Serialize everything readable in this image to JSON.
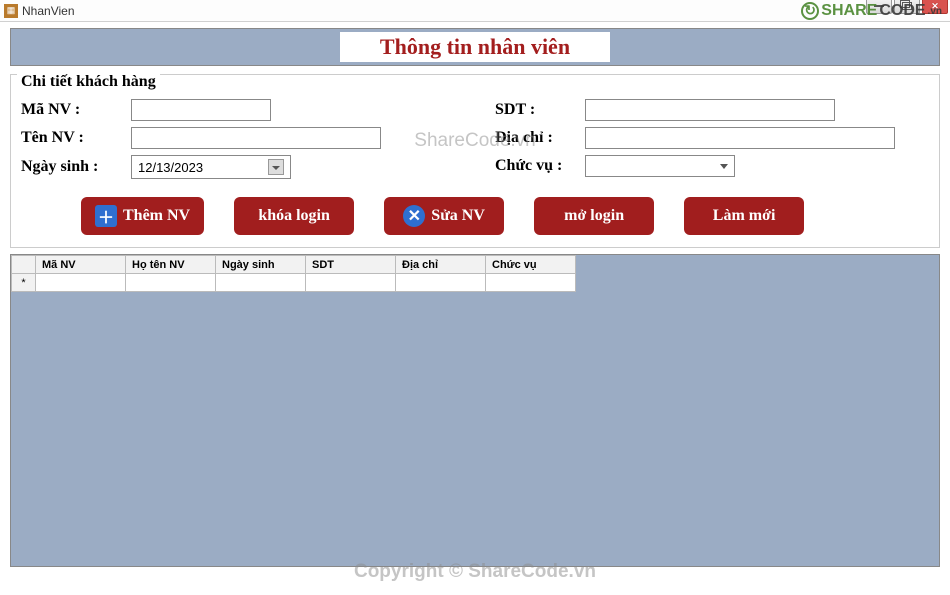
{
  "window": {
    "title": "NhanVien"
  },
  "watermark": {
    "logo_text_1": "SHARE",
    "logo_text_2": "CODE",
    "logo_text_3": ".vn",
    "center": "ShareCode.vn",
    "footer": "Copyright © ShareCode.vn"
  },
  "banner": {
    "title": "Thông tin nhân viên"
  },
  "groupbox": {
    "legend": "Chi tiết khách hàng",
    "labels": {
      "ma_nv": "Mã NV :",
      "sdt": "SDT :",
      "ten_nv": "Tên NV :",
      "dia_chi": "Địa chỉ :",
      "ngay_sinh": "Ngày sinh :",
      "chuc_vu": "Chức vụ :"
    },
    "values": {
      "ma_nv": "",
      "sdt": "",
      "ten_nv": "",
      "dia_chi": "",
      "ngay_sinh": "12/13/2023",
      "chuc_vu": ""
    }
  },
  "buttons": {
    "them": "Thêm NV",
    "khoa": "khóa login",
    "sua": "Sửa NV",
    "mo": "mở login",
    "lammoi": "Làm mới"
  },
  "grid": {
    "columns": [
      "Mã NV",
      "Họ tên NV",
      "Ngày sinh",
      "SDT",
      "Địa chỉ",
      "Chức vụ"
    ],
    "new_row_marker": "*"
  }
}
